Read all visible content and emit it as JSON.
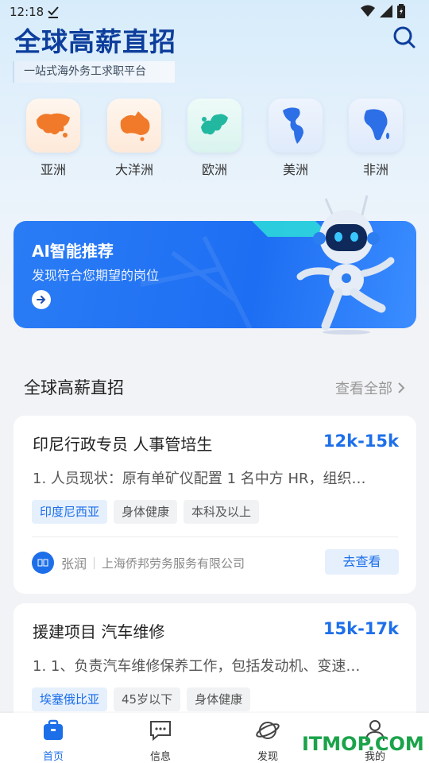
{
  "status_bar": {
    "time": "12:18"
  },
  "header": {
    "title": "全球高薪直招",
    "subtitle": "一站式海外务工求职平台"
  },
  "regions": [
    {
      "label": "亚洲",
      "icon": "asia-map-icon",
      "color": "#f07a2a"
    },
    {
      "label": "大洋洲",
      "icon": "oceania-map-icon",
      "color": "#f07a2a"
    },
    {
      "label": "欧洲",
      "icon": "europe-map-icon",
      "color": "#22b8a0"
    },
    {
      "label": "美洲",
      "icon": "americas-map-icon",
      "color": "#2c6fe6"
    },
    {
      "label": "非洲",
      "icon": "africa-map-icon",
      "color": "#2c6fe6"
    }
  ],
  "ai_banner": {
    "title": "AI智能推荐",
    "description": "发现符合您期望的岗位"
  },
  "section": {
    "title": "全球高薪直招",
    "more_label": "查看全部"
  },
  "jobs": [
    {
      "title": "印尼行政专员 人事管培生",
      "salary": "12k-15k",
      "description": "1. 人员现状：原有单矿仪配置 1 名中方 HR，组织…",
      "tags": [
        "印度尼西亚",
        "身体健康",
        "本科及以上"
      ],
      "recruiter": "张润",
      "company": "上海侨邦劳务服务有限公司",
      "action_label": "去查看"
    },
    {
      "title": "援建项目 汽车维修",
      "salary": "15k-17k",
      "description": "1. 1、负责汽车维修保养工作，包括发动机、变速…",
      "tags": [
        "埃塞俄比亚",
        "45岁以下",
        "身体健康"
      ]
    }
  ],
  "bottom_nav": [
    {
      "label": "首页",
      "icon": "home-icon",
      "active": true
    },
    {
      "label": "信息",
      "icon": "message-icon",
      "active": false
    },
    {
      "label": "发现",
      "icon": "discover-icon",
      "active": false
    },
    {
      "label": "我的",
      "icon": "profile-icon",
      "active": false
    }
  ],
  "watermark": "ITMOP.COM",
  "colors": {
    "primary": "#1d6fe9",
    "title": "#0d3e9c"
  }
}
